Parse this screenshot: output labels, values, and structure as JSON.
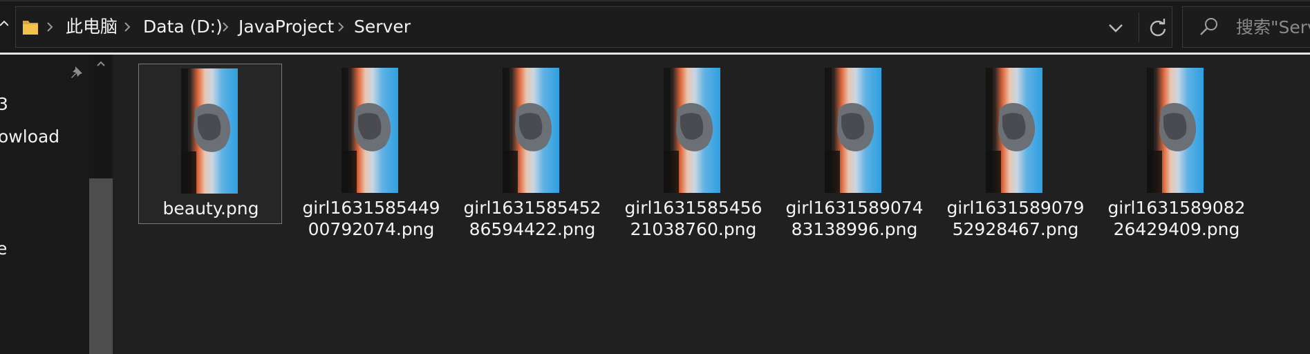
{
  "address_bar": {
    "breadcrumbs": [
      "此电脑",
      "Data (D:)",
      "JavaProject",
      "Server"
    ],
    "folder_icon": "folder-icon",
    "dropdown_icon": "chevron-down-icon",
    "refresh_icon": "refresh-icon"
  },
  "search": {
    "placeholder": "搜索\"Server\"",
    "icon": "search-icon"
  },
  "nav_pane": {
    "items": [
      "3",
      "owload",
      "e"
    ],
    "pin_icon": "pin-icon"
  },
  "files": [
    {
      "line1": "beauty.png",
      "line2": "",
      "selected": true
    },
    {
      "line1": "girl1631585449",
      "line2": "00792074.png",
      "selected": false
    },
    {
      "line1": "girl1631585452",
      "line2": "86594422.png",
      "selected": false
    },
    {
      "line1": "girl1631585456",
      "line2": "21038760.png",
      "selected": false
    },
    {
      "line1": "girl1631589074",
      "line2": "83138996.png",
      "selected": false
    },
    {
      "line1": "girl1631589079",
      "line2": "52928467.png",
      "selected": false
    },
    {
      "line1": "girl1631589082",
      "line2": "26429409.png",
      "selected": false
    }
  ],
  "colors": {
    "background": "#191919",
    "content_background": "#202020",
    "text": "#f2f2f2",
    "accent_folder": "#f3c24a",
    "thumbnail_sky": "#2e9fe0",
    "thumbnail_sunset": "#e0683e"
  }
}
